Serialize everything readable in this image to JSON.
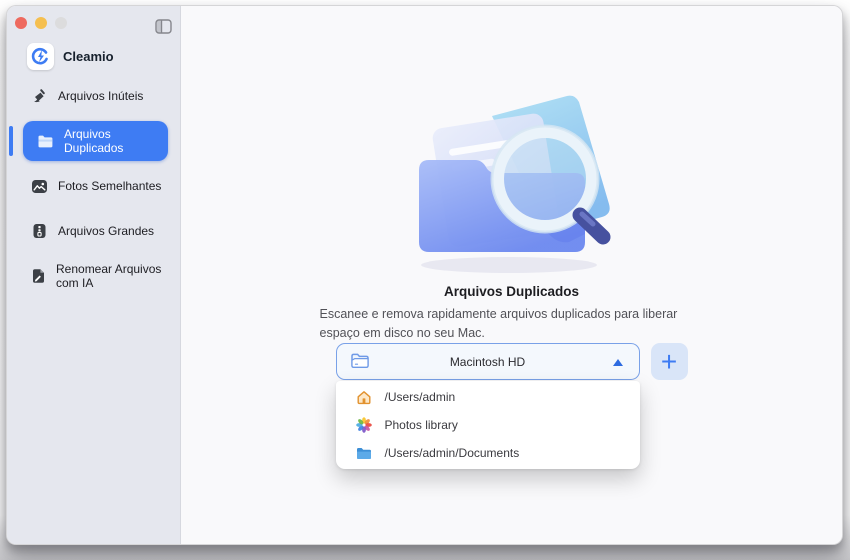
{
  "window": {
    "traffic_lights": [
      "close",
      "minimize",
      "zoom"
    ],
    "sidebar_toggle_icon": "sidebar-toggle-icon"
  },
  "sidebar": {
    "app_name": "Cleamio",
    "logo_icon": "cleamio-logo-icon",
    "items": [
      {
        "label": "Arquivos Inúteis",
        "icon": "broom-icon",
        "selected": false
      },
      {
        "label": "Arquivos Duplicados",
        "icon": "duplicate-folder-icon",
        "selected": true
      },
      {
        "label": "Fotos Semelhantes",
        "icon": "similar-photos-icon",
        "selected": false
      },
      {
        "label": "Arquivos Grandes",
        "icon": "large-files-icon",
        "selected": false
      },
      {
        "label": "Renomear Arquivos com IA",
        "icon": "ai-rename-icon",
        "selected": false
      }
    ]
  },
  "main": {
    "title": "Arquivos Duplicados",
    "description": "Escanee e remova rapidamente arquivos duplicados para liberar espaço em disco no seu Mac.",
    "illustration": "folder-with-magnifier-illustration",
    "scan_target": {
      "value": "Macintosh HD",
      "icon": "folder-outline-icon",
      "caret": "caret-up-icon"
    },
    "add_button_label": "+",
    "dropdown_items": [
      {
        "label": "/Users/admin",
        "icon": "home-icon"
      },
      {
        "label": "Photos library",
        "icon": "photos-app-icon"
      },
      {
        "label": "/Users/admin/Documents",
        "icon": "blue-folder-icon"
      }
    ]
  },
  "colors": {
    "accent_blue": "#3e7cf3",
    "sidebar_bg": "#e5e7ee",
    "main_bg": "#f9f9fb",
    "dropdown_border": "#79a1e8",
    "add_button_bg": "#d9e5f8",
    "traffic_red": "#ee6a5f",
    "traffic_yellow": "#f5bf4f",
    "traffic_gray": "#dcdcdd"
  }
}
